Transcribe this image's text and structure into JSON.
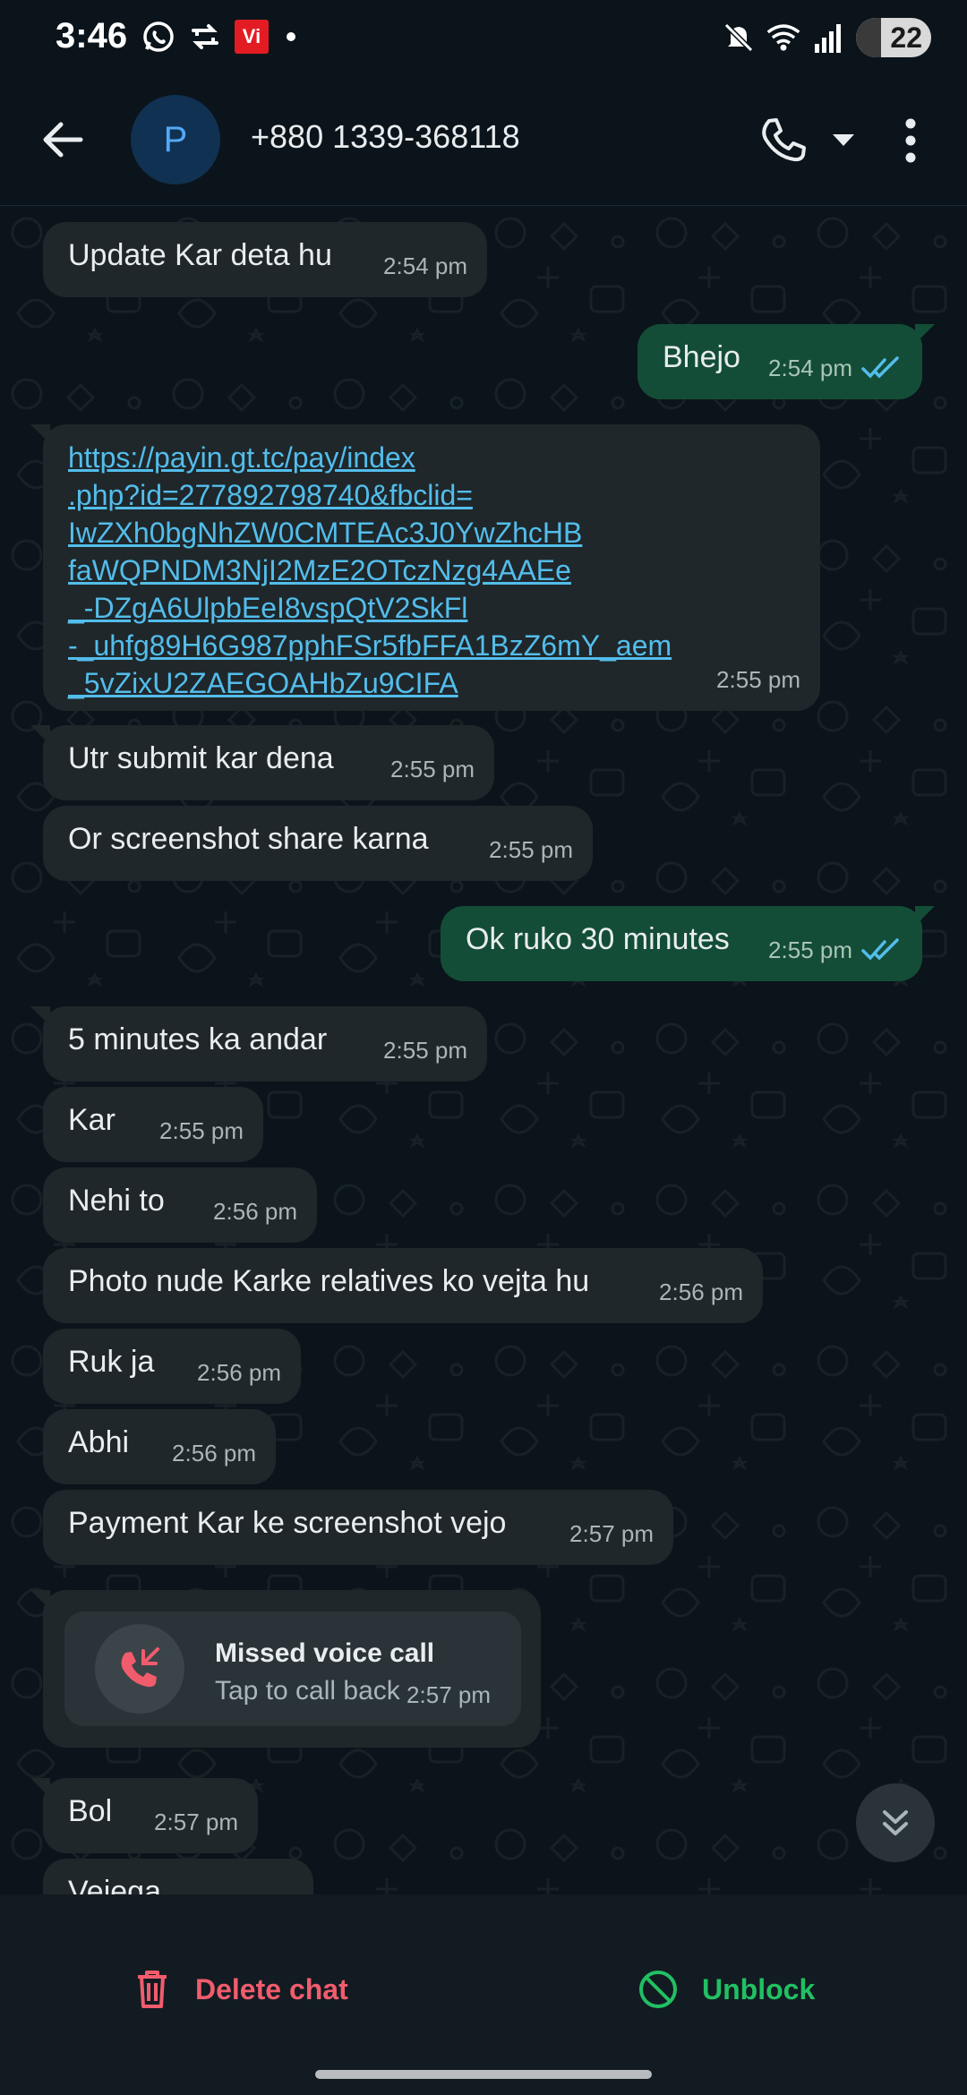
{
  "status_bar": {
    "time": "3:46",
    "carrier_badge": "Vi",
    "battery": "22",
    "icons": [
      "whatsapp-icon",
      "sync-icon",
      "vi-icon",
      "dot",
      "mute-icon",
      "wifi-icon",
      "signal-icon",
      "battery-icon"
    ]
  },
  "header": {
    "avatar_letter": "P",
    "contact": "+880 1339-368118"
  },
  "messages": [
    {
      "dir": "in",
      "text": "Update Kar deta hu",
      "time": "2:54 pm"
    },
    {
      "dir": "out",
      "text": "Bhejo",
      "time": "2:54 pm",
      "read": true
    },
    {
      "dir": "in",
      "type": "link",
      "lines": [
        "https://payin.gt.tc/pay/index",
        ".php?id=277892798740&fbclid=",
        "IwZXh0bgNhZW0CMTEAc3J0YwZhcHB",
        "faWQPNDM3NjI2MzE2OTczNzg4AAEe",
        "_-DZgA6UlpbEeI8vspQtV2SkFl",
        "-_uhfg89H6G987pphFSr5fbFFA1BzZ6mY_aem",
        "_5vZixU2ZAEGOAHbZu9CIFA"
      ],
      "time": "2:55 pm"
    },
    {
      "dir": "in",
      "text": "Utr submit kar dena",
      "time": "2:55 pm"
    },
    {
      "dir": "in",
      "text": "Or screenshot share karna",
      "time": "2:55 pm"
    },
    {
      "dir": "out",
      "text": "Ok ruko 30 minutes",
      "time": "2:55 pm",
      "read": true
    },
    {
      "dir": "in",
      "text": "5 minutes ka andar",
      "time": "2:55 pm"
    },
    {
      "dir": "in",
      "text": "Kar",
      "time": "2:55 pm"
    },
    {
      "dir": "in",
      "text": "Nehi to",
      "time": "2:56 pm"
    },
    {
      "dir": "in",
      "text": "Photo nude Karke relatives ko vejta hu",
      "time": "2:56 pm"
    },
    {
      "dir": "in",
      "text": "Ruk ja",
      "time": "2:56 pm"
    },
    {
      "dir": "in",
      "text": "Abhi",
      "time": "2:56 pm"
    },
    {
      "dir": "in",
      "text": "Payment Kar ke screenshot vejo",
      "time": "2:57 pm"
    },
    {
      "dir": "in",
      "text": "Bol",
      "time": "2:57 pm"
    },
    {
      "dir": "in",
      "text": "Vejega",
      "time": ""
    }
  ],
  "missed_call": {
    "title": "Missed voice call",
    "subtitle": "Tap to call back",
    "time": "2:57 pm"
  },
  "bottom": {
    "delete_label": "Delete chat",
    "unblock_label": "Unblock"
  },
  "colors": {
    "background": "#0b141a",
    "incoming_bubble": "#1f272a",
    "outgoing_bubble": "#144d37",
    "link": "#53bdeb",
    "read_ticks": "#53bdeb",
    "delete": "#f15c6d",
    "unblock": "#21c063"
  }
}
